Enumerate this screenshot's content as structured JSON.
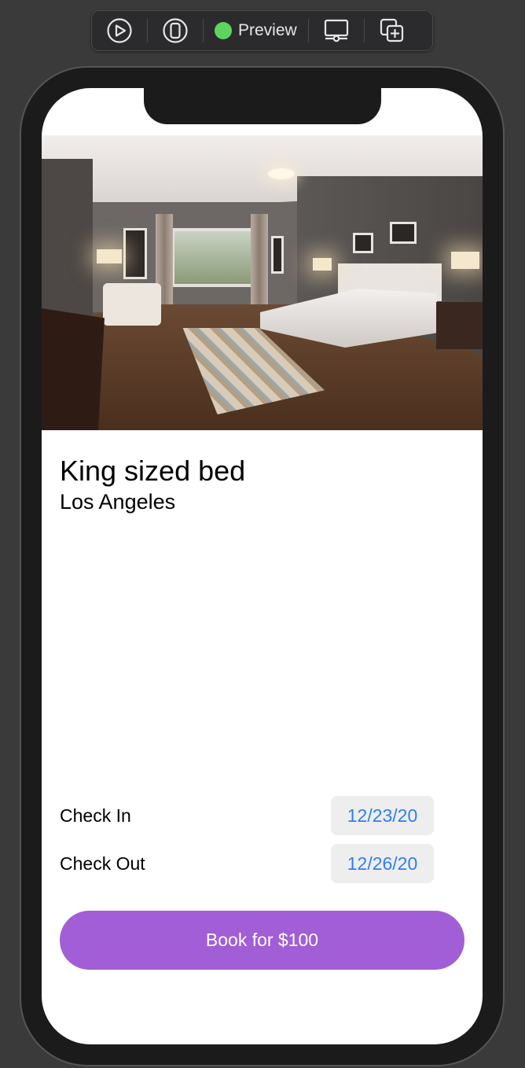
{
  "toolbar": {
    "preview_label": "Preview",
    "status_color": "#5ed460",
    "buttons": [
      "live-preview-icon",
      "device-icon",
      "device-settings-icon",
      "duplicate-icon"
    ]
  },
  "listing": {
    "title": "King sized bed",
    "location": "Los Angeles",
    "image": "bedroom-photo"
  },
  "booking": {
    "check_in_label": "Check In",
    "check_in_date": "12/23/20",
    "check_out_label": "Check Out",
    "check_out_date": "12/26/20",
    "book_button_label": "Book for $100",
    "accent_color": "#a25ed6",
    "date_color": "#2f7ef5"
  }
}
